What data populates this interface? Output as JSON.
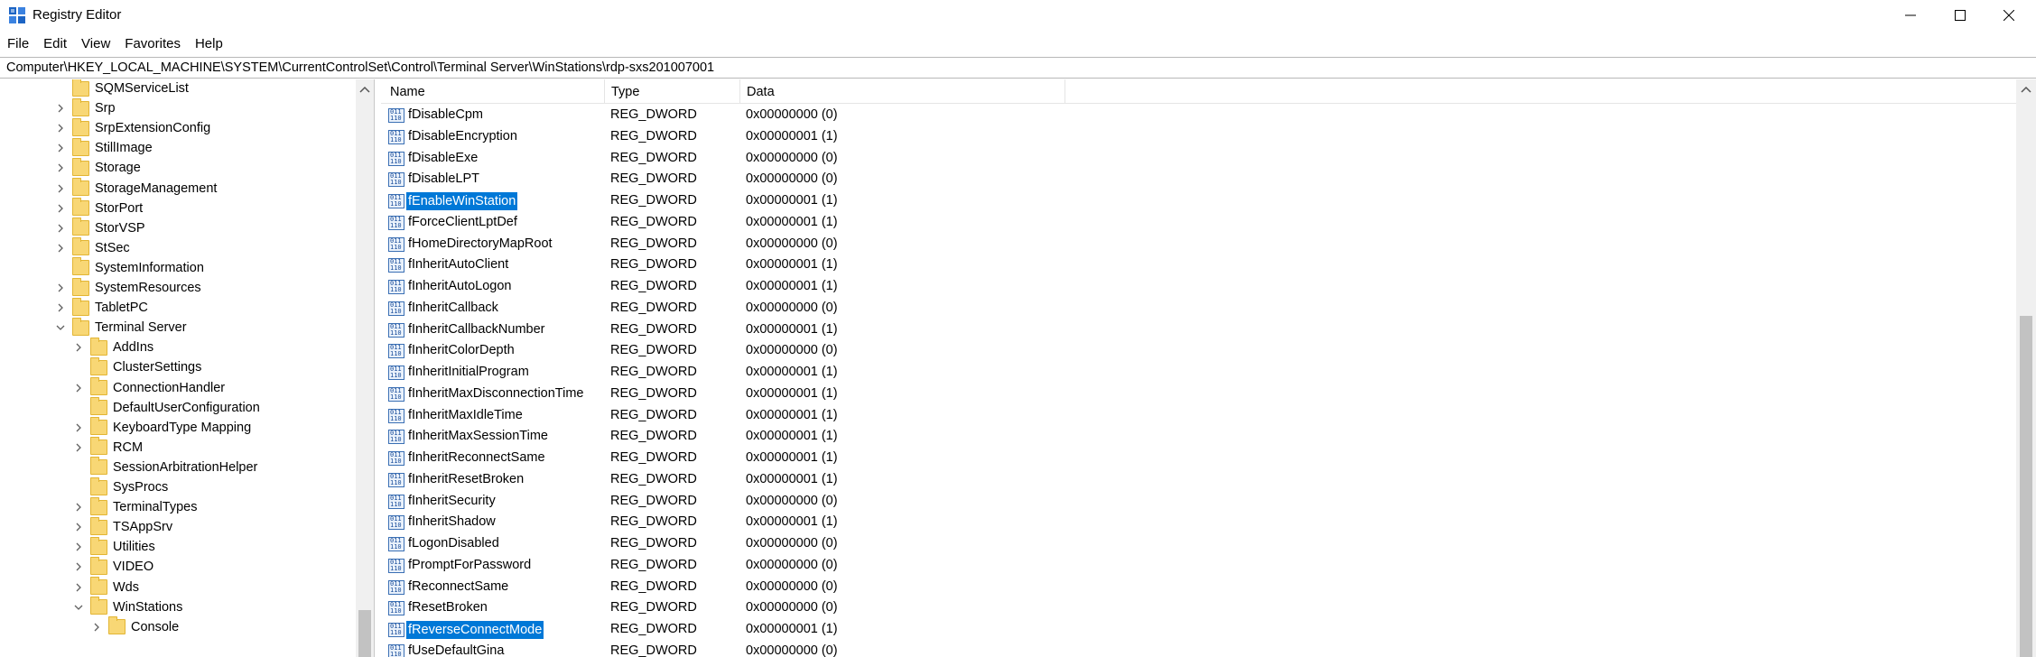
{
  "window": {
    "title": "Registry Editor",
    "minimize_label": "",
    "maximize_label": "",
    "close_label": ""
  },
  "menu": [
    "File",
    "Edit",
    "View",
    "Favorites",
    "Help"
  ],
  "address": "Computer\\HKEY_LOCAL_MACHINE\\SYSTEM\\CurrentControlSet\\Control\\Terminal Server\\WinStations\\rdp-sxs201007001",
  "tree": [
    {
      "label": "SQMServiceList",
      "level": 0,
      "chevron": "none"
    },
    {
      "label": "Srp",
      "level": 0,
      "chevron": "right"
    },
    {
      "label": "SrpExtensionConfig",
      "level": 0,
      "chevron": "right"
    },
    {
      "label": "StillImage",
      "level": 0,
      "chevron": "right"
    },
    {
      "label": "Storage",
      "level": 0,
      "chevron": "right"
    },
    {
      "label": "StorageManagement",
      "level": 0,
      "chevron": "right"
    },
    {
      "label": "StorPort",
      "level": 0,
      "chevron": "right"
    },
    {
      "label": "StorVSP",
      "level": 0,
      "chevron": "right"
    },
    {
      "label": "StSec",
      "level": 0,
      "chevron": "right"
    },
    {
      "label": "SystemInformation",
      "level": 0,
      "chevron": "none"
    },
    {
      "label": "SystemResources",
      "level": 0,
      "chevron": "right"
    },
    {
      "label": "TabletPC",
      "level": 0,
      "chevron": "right"
    },
    {
      "label": "Terminal Server",
      "level": 0,
      "chevron": "down"
    },
    {
      "label": "AddIns",
      "level": 1,
      "chevron": "right"
    },
    {
      "label": "ClusterSettings",
      "level": 1,
      "chevron": "none"
    },
    {
      "label": "ConnectionHandler",
      "level": 1,
      "chevron": "right"
    },
    {
      "label": "DefaultUserConfiguration",
      "level": 1,
      "chevron": "none"
    },
    {
      "label": "KeyboardType Mapping",
      "level": 1,
      "chevron": "right"
    },
    {
      "label": "RCM",
      "level": 1,
      "chevron": "right"
    },
    {
      "label": "SessionArbitrationHelper",
      "level": 1,
      "chevron": "none"
    },
    {
      "label": "SysProcs",
      "level": 1,
      "chevron": "none"
    },
    {
      "label": "TerminalTypes",
      "level": 1,
      "chevron": "right"
    },
    {
      "label": "TSAppSrv",
      "level": 1,
      "chevron": "right"
    },
    {
      "label": "Utilities",
      "level": 1,
      "chevron": "right"
    },
    {
      "label": "VIDEO",
      "level": 1,
      "chevron": "right"
    },
    {
      "label": "Wds",
      "level": 1,
      "chevron": "right"
    },
    {
      "label": "WinStations",
      "level": 1,
      "chevron": "down"
    },
    {
      "label": "Console",
      "level": 2,
      "chevron": "right"
    }
  ],
  "columns": {
    "name": "Name",
    "type": "Type",
    "data": "Data"
  },
  "values": [
    {
      "name": "fDisableCpm",
      "type": "REG_DWORD",
      "data": "0x00000000 (0)",
      "selected": false
    },
    {
      "name": "fDisableEncryption",
      "type": "REG_DWORD",
      "data": "0x00000001 (1)",
      "selected": false
    },
    {
      "name": "fDisableExe",
      "type": "REG_DWORD",
      "data": "0x00000000 (0)",
      "selected": false
    },
    {
      "name": "fDisableLPT",
      "type": "REG_DWORD",
      "data": "0x00000000 (0)",
      "selected": false
    },
    {
      "name": "fEnableWinStation",
      "type": "REG_DWORD",
      "data": "0x00000001 (1)",
      "selected": true
    },
    {
      "name": "fForceClientLptDef",
      "type": "REG_DWORD",
      "data": "0x00000001 (1)",
      "selected": false
    },
    {
      "name": "fHomeDirectoryMapRoot",
      "type": "REG_DWORD",
      "data": "0x00000000 (0)",
      "selected": false
    },
    {
      "name": "fInheritAutoClient",
      "type": "REG_DWORD",
      "data": "0x00000001 (1)",
      "selected": false
    },
    {
      "name": "fInheritAutoLogon",
      "type": "REG_DWORD",
      "data": "0x00000001 (1)",
      "selected": false
    },
    {
      "name": "fInheritCallback",
      "type": "REG_DWORD",
      "data": "0x00000000 (0)",
      "selected": false
    },
    {
      "name": "fInheritCallbackNumber",
      "type": "REG_DWORD",
      "data": "0x00000001 (1)",
      "selected": false
    },
    {
      "name": "fInheritColorDepth",
      "type": "REG_DWORD",
      "data": "0x00000000 (0)",
      "selected": false
    },
    {
      "name": "fInheritInitialProgram",
      "type": "REG_DWORD",
      "data": "0x00000001 (1)",
      "selected": false
    },
    {
      "name": "fInheritMaxDisconnectionTime",
      "type": "REG_DWORD",
      "data": "0x00000001 (1)",
      "selected": false
    },
    {
      "name": "fInheritMaxIdleTime",
      "type": "REG_DWORD",
      "data": "0x00000001 (1)",
      "selected": false
    },
    {
      "name": "fInheritMaxSessionTime",
      "type": "REG_DWORD",
      "data": "0x00000001 (1)",
      "selected": false
    },
    {
      "name": "fInheritReconnectSame",
      "type": "REG_DWORD",
      "data": "0x00000001 (1)",
      "selected": false
    },
    {
      "name": "fInheritResetBroken",
      "type": "REG_DWORD",
      "data": "0x00000001 (1)",
      "selected": false
    },
    {
      "name": "fInheritSecurity",
      "type": "REG_DWORD",
      "data": "0x00000000 (0)",
      "selected": false
    },
    {
      "name": "fInheritShadow",
      "type": "REG_DWORD",
      "data": "0x00000001 (1)",
      "selected": false
    },
    {
      "name": "fLogonDisabled",
      "type": "REG_DWORD",
      "data": "0x00000000 (0)",
      "selected": false
    },
    {
      "name": "fPromptForPassword",
      "type": "REG_DWORD",
      "data": "0x00000000 (0)",
      "selected": false
    },
    {
      "name": "fReconnectSame",
      "type": "REG_DWORD",
      "data": "0x00000000 (0)",
      "selected": false
    },
    {
      "name": "fResetBroken",
      "type": "REG_DWORD",
      "data": "0x00000000 (0)",
      "selected": false
    },
    {
      "name": "fReverseConnectMode",
      "type": "REG_DWORD",
      "data": "0x00000001 (1)",
      "selected": true
    },
    {
      "name": "fUseDefaultGina",
      "type": "REG_DWORD",
      "data": "0x00000000 (0)",
      "selected": false
    }
  ],
  "colors": {
    "selection": "#0078d7",
    "folder": "#f8d775"
  },
  "icons": {
    "tree_folder": "folder-icon",
    "value": "reg-dword-icon"
  }
}
